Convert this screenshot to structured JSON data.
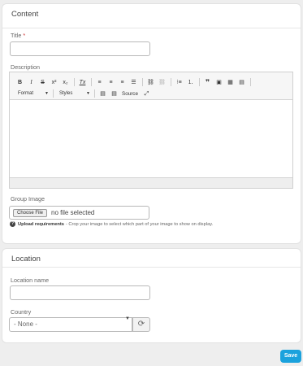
{
  "content_panel": {
    "heading": "Content",
    "title_label": "Title",
    "title_required_mark": "*",
    "title_value": "",
    "description_label": "Description",
    "editor": {
      "bold": "B",
      "italic": "I",
      "strike": "S",
      "superscript": "x²",
      "subscript": "x₂",
      "remove_format": "Tx",
      "format_combo": "Format",
      "styles_combo": "Styles",
      "source_label": "Source"
    },
    "group_image_label": "Group Image",
    "choose_file_label": "Choose File",
    "no_file_text": "no file selected",
    "help_bold": "Upload requirements",
    "help_text": "- Crop your image to select which part of your image to show on display."
  },
  "location_panel": {
    "heading": "Location",
    "location_name_label": "Location name",
    "location_name_value": "",
    "country_label": "Country",
    "country_selected": "- None -"
  },
  "footer": {
    "save_label": "Save"
  },
  "colors": {
    "accent": "#1ba2dd",
    "background": "#eeeeee"
  }
}
